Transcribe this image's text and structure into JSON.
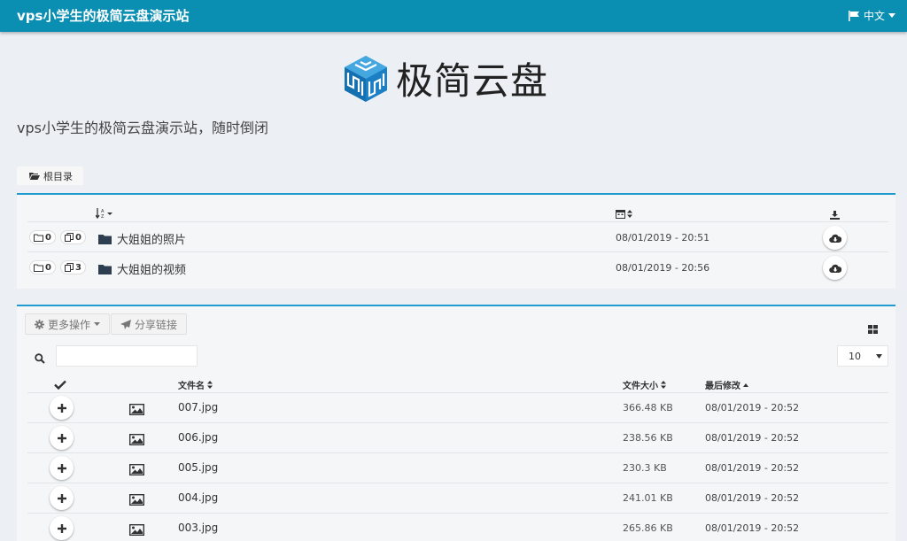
{
  "header": {
    "site_title": "vps小学生的极简云盘演示站",
    "language": "中文"
  },
  "logo": {
    "text": "极简云盘"
  },
  "subtitle": "vps小学生的极简云盘演示站，随时倒闭",
  "breadcrumb": {
    "root_label": "根目录"
  },
  "folders": [
    {
      "name": "大姐姐的照片",
      "folder_count": "0",
      "file_count": "0",
      "date": "08/01/2019 - 20:51"
    },
    {
      "name": "大姐姐的视频",
      "folder_count": "0",
      "file_count": "3",
      "date": "08/01/2019 - 20:56"
    }
  ],
  "toolbar": {
    "more_actions": "更多操作",
    "share_link": "分享链接"
  },
  "search": {
    "value": ""
  },
  "page_size": "10",
  "files_table": {
    "headers": {
      "name": "文件名",
      "size": "文件大小",
      "modified": "最后修改"
    },
    "rows": [
      {
        "name": "007.jpg",
        "size": "366.48 KB",
        "modified": "08/01/2019 - 20:52"
      },
      {
        "name": "006.jpg",
        "size": "238.56 KB",
        "modified": "08/01/2019 - 20:52"
      },
      {
        "name": "005.jpg",
        "size": "230.3 KB",
        "modified": "08/01/2019 - 20:52"
      },
      {
        "name": "004.jpg",
        "size": "241.01 KB",
        "modified": "08/01/2019 - 20:52"
      },
      {
        "name": "003.jpg",
        "size": "265.86 KB",
        "modified": "08/01/2019 - 20:52"
      }
    ]
  },
  "colors": {
    "header_bg": "#0a8fb3",
    "panel_border": "#1f9bcf",
    "logo_blue": "#1a7fc4"
  }
}
